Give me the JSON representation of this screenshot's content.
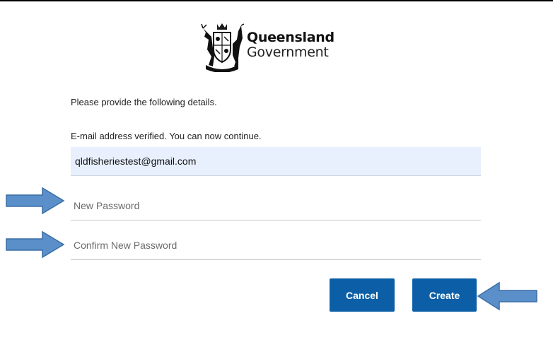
{
  "logo": {
    "line1": "Queensland",
    "line2": "Government"
  },
  "form": {
    "intro_text": "Please provide the following details.",
    "verified_text": "E-mail address verified. You can now continue.",
    "email_value": "qldfisheriestest@gmail.com",
    "new_password_placeholder": "New Password",
    "confirm_password_placeholder": "Confirm New Password"
  },
  "buttons": {
    "cancel_label": "Cancel",
    "create_label": "Create"
  },
  "colors": {
    "button_blue": "#0c5fa6",
    "autofill_bg": "#e8f0fe",
    "arrow_fill": "#5b8fc9",
    "arrow_stroke": "#3a6ea5"
  },
  "icons": {
    "crest": "queensland-coat-of-arms-icon",
    "arrow": "right-arrow-icon",
    "arrow_left": "left-arrow-icon"
  }
}
